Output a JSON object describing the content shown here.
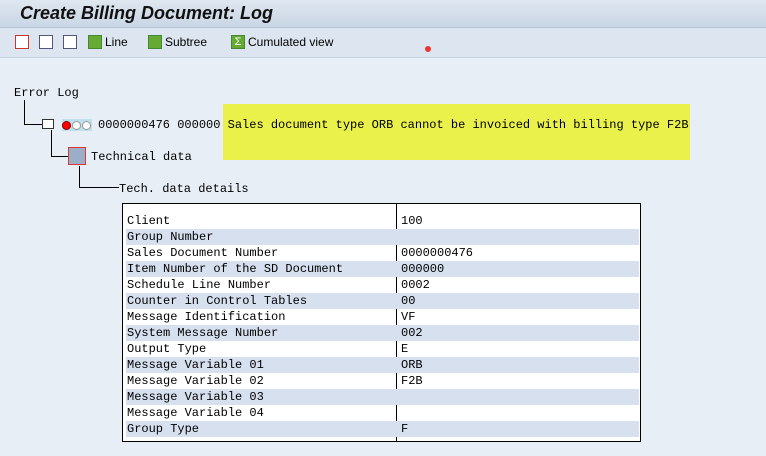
{
  "title": "Create Billing Document: Log",
  "toolbar": {
    "line": "Line",
    "subtree": "Subtree",
    "cumulated": "Cumulated view"
  },
  "tree": {
    "root": "Error Log",
    "doc": "0000000476",
    "item": "000000",
    "message": "Sales document type ORB cannot be invoiced with billing type F2B",
    "technical": "Technical data",
    "details": "Tech. data details"
  },
  "highlight_color": "#eaf14b",
  "details": [
    {
      "k": "Client",
      "v": "100"
    },
    {
      "k": "Group Number",
      "v": ""
    },
    {
      "k": "Sales Document Number",
      "v": "0000000476"
    },
    {
      "k": "Item Number of the SD Document",
      "v": "000000"
    },
    {
      "k": "Schedule Line Number",
      "v": "0002"
    },
    {
      "k": "Counter in Control Tables",
      "v": "00"
    },
    {
      "k": "Message Identification",
      "v": "VF"
    },
    {
      "k": "System Message Number",
      "v": "002"
    },
    {
      "k": "Output Type",
      "v": "E"
    },
    {
      "k": "Message Variable 01",
      "v": "ORB"
    },
    {
      "k": "Message Variable 02",
      "v": "F2B"
    },
    {
      "k": "Message Variable 03",
      "v": ""
    },
    {
      "k": "Message Variable 04",
      "v": ""
    },
    {
      "k": "Group Type",
      "v": "F"
    }
  ]
}
